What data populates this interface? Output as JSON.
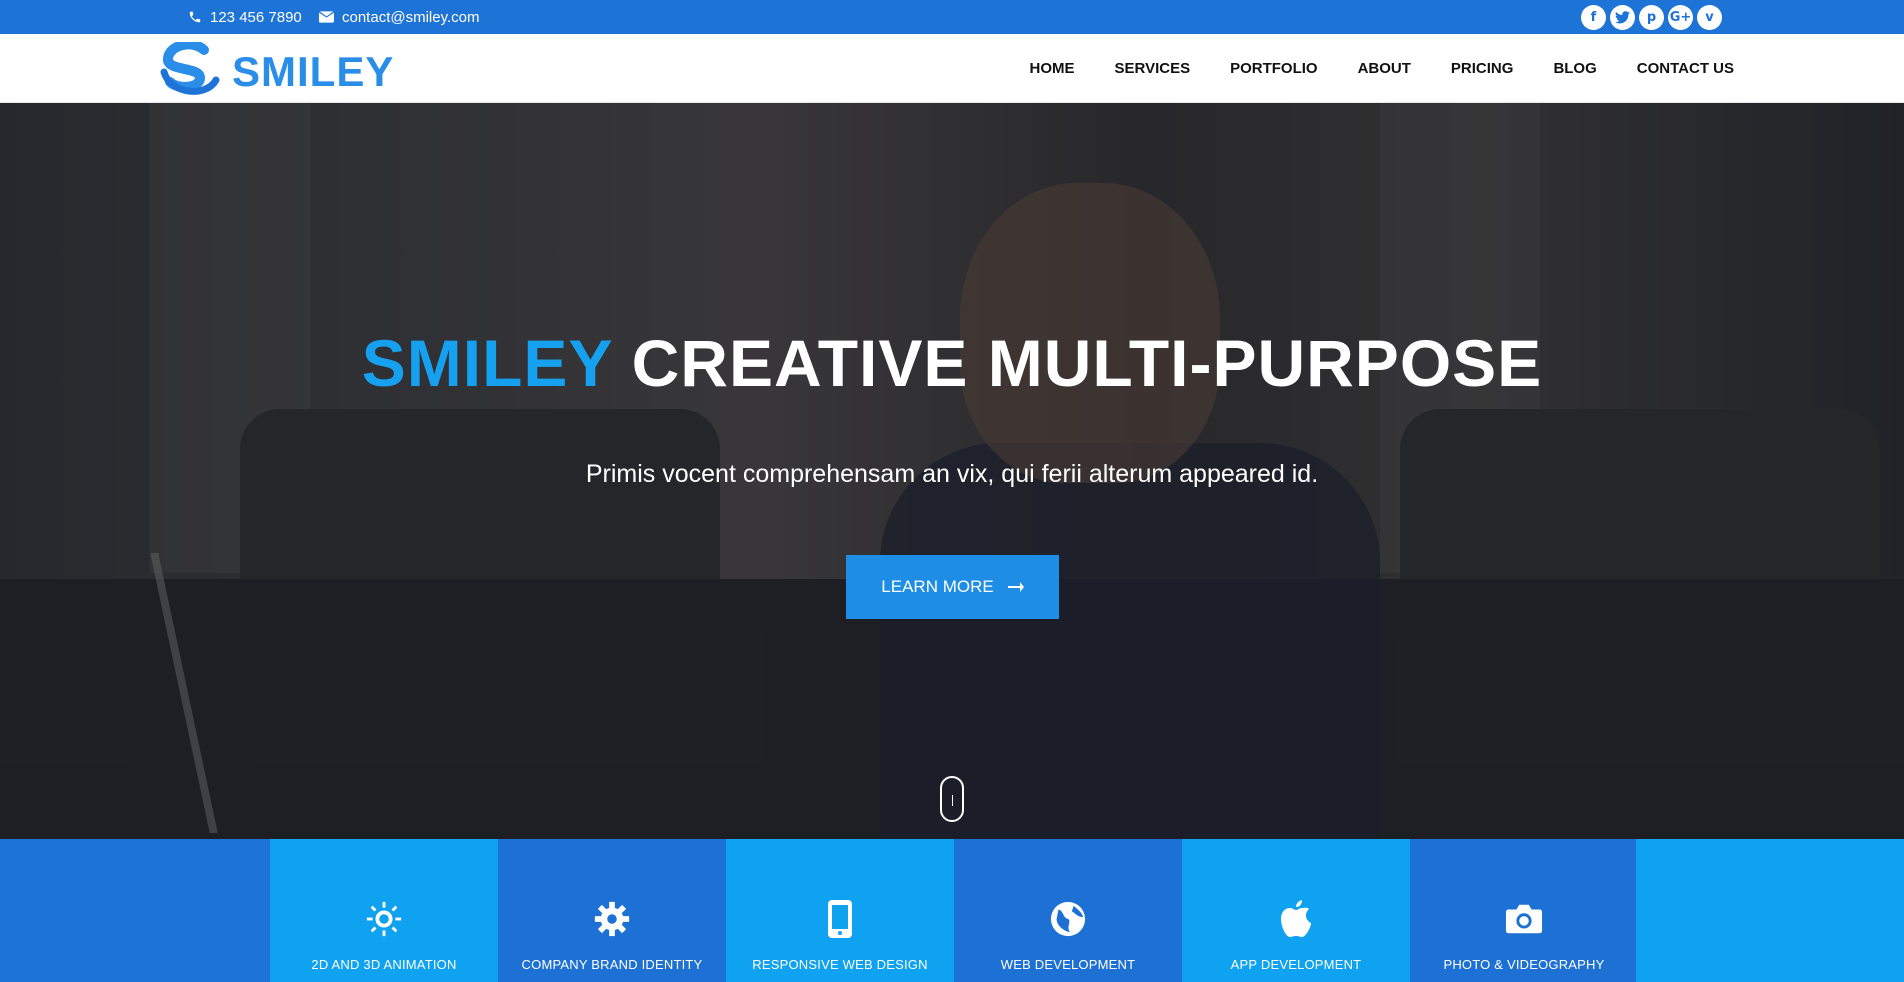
{
  "topbar": {
    "phone": "123 456 7890",
    "email": "contact@smiley.com",
    "socials": [
      {
        "icon": "facebook-icon",
        "glyph": "f"
      },
      {
        "icon": "twitter-icon",
        "glyph": "t"
      },
      {
        "icon": "pinterest-icon",
        "glyph": "p"
      },
      {
        "icon": "google-plus-icon",
        "glyph": "G+"
      },
      {
        "icon": "vimeo-icon",
        "glyph": "v"
      }
    ]
  },
  "header": {
    "logo_text": "SMILEY",
    "nav": [
      "HOME",
      "SERVICES",
      "PORTFOLIO",
      "ABOUT",
      "PRICING",
      "BLOG",
      "CONTACT US"
    ]
  },
  "hero": {
    "title_accent": "SMILEY",
    "title_rest": "CREATIVE MULTI-PURPOSE",
    "subtitle": "Primis vocent comprehensam an vix, qui ferii alterum appeared id.",
    "button_label": "LEARN MORE"
  },
  "services": [
    {
      "label": "2D AND 3D ANIMATION",
      "icon": "sun-icon"
    },
    {
      "label": "COMPANY BRAND IDENTITY",
      "icon": "gear-icon"
    },
    {
      "label": "RESPONSIVE WEB DESIGN",
      "icon": "mobile-phone-icon"
    },
    {
      "label": "WEB DEVELOPMENT",
      "icon": "globe-icon"
    },
    {
      "label": "APP DEVELOPMENT",
      "icon": "apple-icon"
    },
    {
      "label": "PHOTO & VIDEOGRAPHY",
      "icon": "camera-icon"
    }
  ],
  "colors": {
    "primary": "#1e73d6",
    "accent": "#16a0f0",
    "button": "#1e8de6",
    "tile_light": "#0fa2f0",
    "tile_dark": "#1d71d4"
  }
}
